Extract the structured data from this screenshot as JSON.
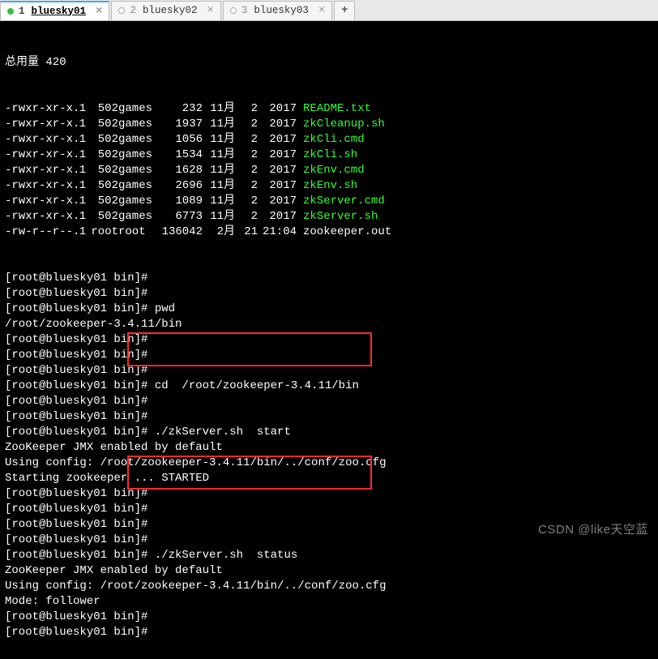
{
  "tabs": {
    "items": [
      {
        "num": "1",
        "name": "bluesky01",
        "active": true
      },
      {
        "num": "2",
        "name": "bluesky02",
        "active": false
      },
      {
        "num": "3",
        "name": "bluesky03",
        "active": false
      }
    ],
    "add": "+"
  },
  "terminal": {
    "total_label": "总用量 420",
    "rows": [
      {
        "perm": "-rwxr-xr-x.",
        "links": "1",
        "owner": "502",
        "group": "games",
        "size": "232",
        "month": "11月",
        "day": "2",
        "time": "2017",
        "name": "README.txt",
        "color": "green"
      },
      {
        "perm": "-rwxr-xr-x.",
        "links": "1",
        "owner": "502",
        "group": "games",
        "size": "1937",
        "month": "11月",
        "day": "2",
        "time": "2017",
        "name": "zkCleanup.sh",
        "color": "green"
      },
      {
        "perm": "-rwxr-xr-x.",
        "links": "1",
        "owner": "502",
        "group": "games",
        "size": "1056",
        "month": "11月",
        "day": "2",
        "time": "2017",
        "name": "zkCli.cmd",
        "color": "green"
      },
      {
        "perm": "-rwxr-xr-x.",
        "links": "1",
        "owner": "502",
        "group": "games",
        "size": "1534",
        "month": "11月",
        "day": "2",
        "time": "2017",
        "name": "zkCli.sh",
        "color": "green"
      },
      {
        "perm": "-rwxr-xr-x.",
        "links": "1",
        "owner": "502",
        "group": "games",
        "size": "1628",
        "month": "11月",
        "day": "2",
        "time": "2017",
        "name": "zkEnv.cmd",
        "color": "green"
      },
      {
        "perm": "-rwxr-xr-x.",
        "links": "1",
        "owner": "502",
        "group": "games",
        "size": "2696",
        "month": "11月",
        "day": "2",
        "time": "2017",
        "name": "zkEnv.sh",
        "color": "green"
      },
      {
        "perm": "-rwxr-xr-x.",
        "links": "1",
        "owner": "502",
        "group": "games",
        "size": "1089",
        "month": "11月",
        "day": "2",
        "time": "2017",
        "name": "zkServer.cmd",
        "color": "green"
      },
      {
        "perm": "-rwxr-xr-x.",
        "links": "1",
        "owner": "502",
        "group": "games",
        "size": "6773",
        "month": "11月",
        "day": "2",
        "time": "2017",
        "name": "zkServer.sh",
        "color": "green"
      },
      {
        "perm": "-rw-r--r--.",
        "links": "1",
        "owner": "root",
        "group": "root",
        "size": "136042",
        "month": "2月",
        "day": "21",
        "time": "21:04",
        "name": "zookeeper.out",
        "color": "white"
      }
    ],
    "lines": [
      "[root@bluesky01 bin]#",
      "[root@bluesky01 bin]#",
      "[root@bluesky01 bin]# pwd",
      "/root/zookeeper-3.4.11/bin",
      "[root@bluesky01 bin]#",
      "[root@bluesky01 bin]#",
      "[root@bluesky01 bin]#",
      "[root@bluesky01 bin]# cd  /root/zookeeper-3.4.11/bin",
      "[root@bluesky01 bin]#",
      "[root@bluesky01 bin]#",
      "[root@bluesky01 bin]# ./zkServer.sh  start",
      "ZooKeeper JMX enabled by default",
      "Using config: /root/zookeeper-3.4.11/bin/../conf/zoo.cfg",
      "Starting zookeeper ... STARTED",
      "[root@bluesky01 bin]#",
      "[root@bluesky01 bin]#",
      "[root@bluesky01 bin]#",
      "[root@bluesky01 bin]#",
      "[root@bluesky01 bin]# ./zkServer.sh  status",
      "ZooKeeper JMX enabled by default",
      "Using config: /root/zookeeper-3.4.11/bin/../conf/zoo.cfg",
      "Mode: follower",
      "[root@bluesky01 bin]#",
      "[root@bluesky01 bin]#"
    ]
  },
  "watermark": "CSDN @like天空蓝"
}
